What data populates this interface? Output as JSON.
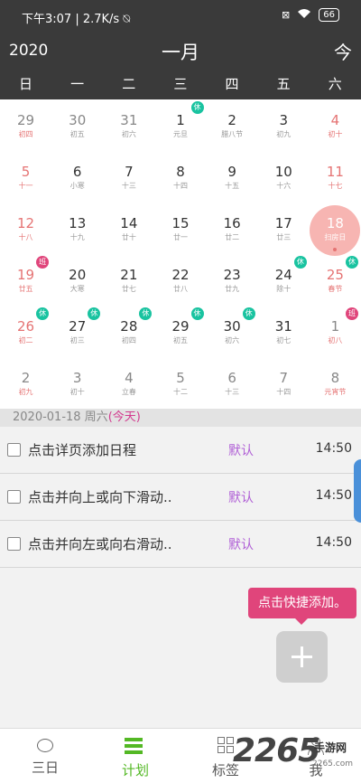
{
  "status_bar": {
    "left_text": "下午3:07 | 2.7K/s ⍉",
    "right_icons": [
      "x-box-icon",
      "wifi-icon"
    ],
    "battery": "66"
  },
  "calendar_header": {
    "year": "2020",
    "month": "一月",
    "today_button": "今"
  },
  "weekdays": [
    "日",
    "一",
    "二",
    "三",
    "四",
    "五",
    "六"
  ],
  "days": [
    {
      "num": "29",
      "sub": "初四",
      "weekend": true,
      "faded": true
    },
    {
      "num": "30",
      "sub": "初五",
      "faded": true
    },
    {
      "num": "31",
      "sub": "初六",
      "faded": true
    },
    {
      "num": "1",
      "sub": "元旦",
      "badge": "休"
    },
    {
      "num": "2",
      "sub": "腊八节"
    },
    {
      "num": "3",
      "sub": "初九"
    },
    {
      "num": "4",
      "sub": "初十",
      "weekend": true
    },
    {
      "num": "5",
      "sub": "十一",
      "weekend": true
    },
    {
      "num": "6",
      "sub": "小寒"
    },
    {
      "num": "7",
      "sub": "十三"
    },
    {
      "num": "8",
      "sub": "十四"
    },
    {
      "num": "9",
      "sub": "十五"
    },
    {
      "num": "10",
      "sub": "十六"
    },
    {
      "num": "11",
      "sub": "十七",
      "weekend": true
    },
    {
      "num": "12",
      "sub": "十八",
      "weekend": true
    },
    {
      "num": "13",
      "sub": "十九"
    },
    {
      "num": "14",
      "sub": "廿十"
    },
    {
      "num": "15",
      "sub": "廿一"
    },
    {
      "num": "16",
      "sub": "廿二"
    },
    {
      "num": "17",
      "sub": "廿三"
    },
    {
      "num": "18",
      "sub": "扫房日",
      "weekend": true,
      "today": true
    },
    {
      "num": "19",
      "sub": "廿五",
      "weekend": true,
      "badge": "班"
    },
    {
      "num": "20",
      "sub": "大寒"
    },
    {
      "num": "21",
      "sub": "廿七"
    },
    {
      "num": "22",
      "sub": "廿八"
    },
    {
      "num": "23",
      "sub": "廿九"
    },
    {
      "num": "24",
      "sub": "除十",
      "badge": "休"
    },
    {
      "num": "25",
      "sub": "春节",
      "weekend": true,
      "badge": "休"
    },
    {
      "num": "26",
      "sub": "初二",
      "weekend": true,
      "badge": "休"
    },
    {
      "num": "27",
      "sub": "初三",
      "badge": "休"
    },
    {
      "num": "28",
      "sub": "初四",
      "badge": "休"
    },
    {
      "num": "29",
      "sub": "初五",
      "badge": "休"
    },
    {
      "num": "30",
      "sub": "初六",
      "badge": "休"
    },
    {
      "num": "31",
      "sub": "初七"
    },
    {
      "num": "1",
      "sub": "初八",
      "weekend": true,
      "faded": true,
      "badge": "班"
    },
    {
      "num": "2",
      "sub": "初九",
      "weekend": true,
      "faded": true
    },
    {
      "num": "3",
      "sub": "初十",
      "faded": true
    },
    {
      "num": "4",
      "sub": "立春",
      "faded": true
    },
    {
      "num": "5",
      "sub": "十二",
      "faded": true
    },
    {
      "num": "6",
      "sub": "十三",
      "faded": true
    },
    {
      "num": "7",
      "sub": "十四",
      "faded": true
    },
    {
      "num": "8",
      "sub": "元宵节",
      "weekend": true,
      "faded": true
    }
  ],
  "date_bar": {
    "date": "2020-01-18 周六",
    "today": "(今天)"
  },
  "tasks": [
    {
      "title": "点击详页添加日程",
      "tag": "默认",
      "time": "14:50"
    },
    {
      "title": "点击并向上或向下滑动..",
      "tag": "默认",
      "time": "14:50"
    },
    {
      "title": "点击并向左或向右滑动..",
      "tag": "默认",
      "time": "14:50"
    }
  ],
  "tooltip": "点击快捷添加。",
  "bottom_nav": [
    {
      "label": "三日",
      "icon": "chat-bubble-icon",
      "active": false
    },
    {
      "label": "计划",
      "icon": "list-icon",
      "active": true
    },
    {
      "label": "标签",
      "icon": "grid-icon",
      "active": false
    },
    {
      "label": "我",
      "icon": "user-icon",
      "active": false
    }
  ],
  "watermark": {
    "big": "2265",
    "small": "手游网",
    "site": "2265.com"
  }
}
